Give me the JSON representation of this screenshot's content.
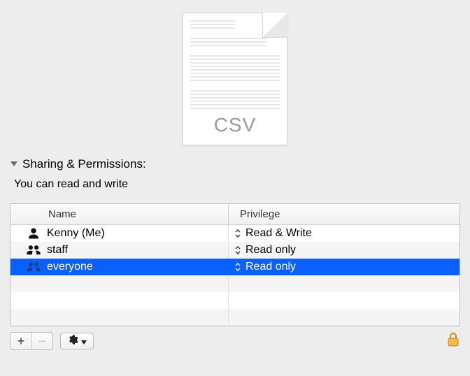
{
  "file": {
    "extension_label": "CSV"
  },
  "section": {
    "title": "Sharing & Permissions:",
    "status": "You can read and write"
  },
  "table": {
    "head": {
      "name": "Name",
      "privilege": "Privilege"
    },
    "rows": [
      {
        "icon": "user",
        "name": "Kenny (Me)",
        "privilege": "Read & Write",
        "selected": false
      },
      {
        "icon": "group",
        "name": "staff",
        "privilege": "Read only",
        "selected": false
      },
      {
        "icon": "group",
        "name": "everyone",
        "privilege": "Read only",
        "selected": true
      }
    ]
  },
  "toolbar": {
    "add": "+",
    "remove": "−"
  }
}
